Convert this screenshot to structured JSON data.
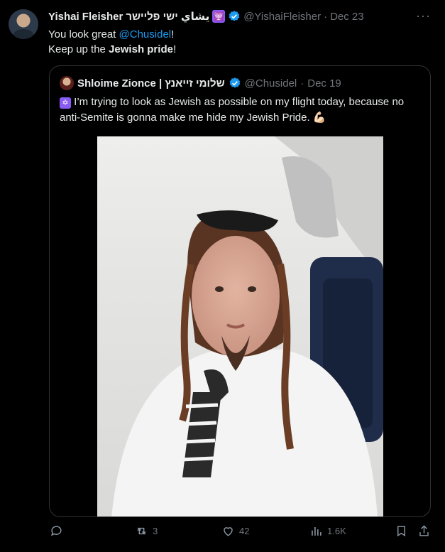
{
  "tweet": {
    "author_name": "Yishai Fleisher",
    "author_name_hebrew": "يشاي ישי פליישר",
    "author_emoji": "🕎",
    "handle": "@YishaiFleisher",
    "separator": "·",
    "date": "Dec 23",
    "text_line1_prefix": "You look great ",
    "mention": "@Chusidel",
    "text_line1_suffix": "!",
    "text_line2_prefix": "Keep up the ",
    "text_line2_bold": "Jewish pride",
    "text_line2_suffix": "!",
    "more_label": "···"
  },
  "quoted": {
    "author_name": "Shloime Zionce | שלומי זייאנץ",
    "handle": "@Chusidel",
    "separator": "·",
    "date": "Dec 19",
    "emoji_star": "✡",
    "text": " I’m trying to look as Jewish as possible on my flight today, because no anti-Semite is gonna make me hide my Jewish Pride. 💪🏻"
  },
  "actions": {
    "reply_count": "",
    "retweet_count": "3",
    "like_count": "42",
    "views_count": "1.6K"
  },
  "colors": {
    "background": "#000000",
    "text": "#e7e9ea",
    "muted": "#71767b",
    "link": "#1d9bf0",
    "verified": "#1d9bf0",
    "border": "#2f3336"
  },
  "icons": [
    "reply-icon",
    "retweet-icon",
    "like-icon",
    "views-icon",
    "bookmark-icon",
    "share-icon",
    "verified-icon",
    "more-icon"
  ]
}
